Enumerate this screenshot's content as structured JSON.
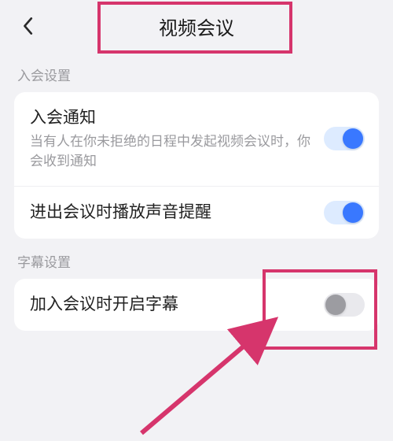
{
  "header": {
    "title": "视频会议"
  },
  "sections": {
    "join": {
      "label": "入会设置",
      "items": {
        "notify": {
          "title": "入会通知",
          "subtitle": "当有人在你未拒绝的日程中发起视频会议时，你会收到通知",
          "on": true
        },
        "sound": {
          "title": "进出会议时播放声音提醒",
          "on": true
        }
      }
    },
    "subtitle": {
      "label": "字幕设置",
      "items": {
        "autoSub": {
          "title": "加入会议时开启字幕",
          "on": false
        }
      }
    }
  },
  "annotation": {
    "color": "#d6356c"
  }
}
